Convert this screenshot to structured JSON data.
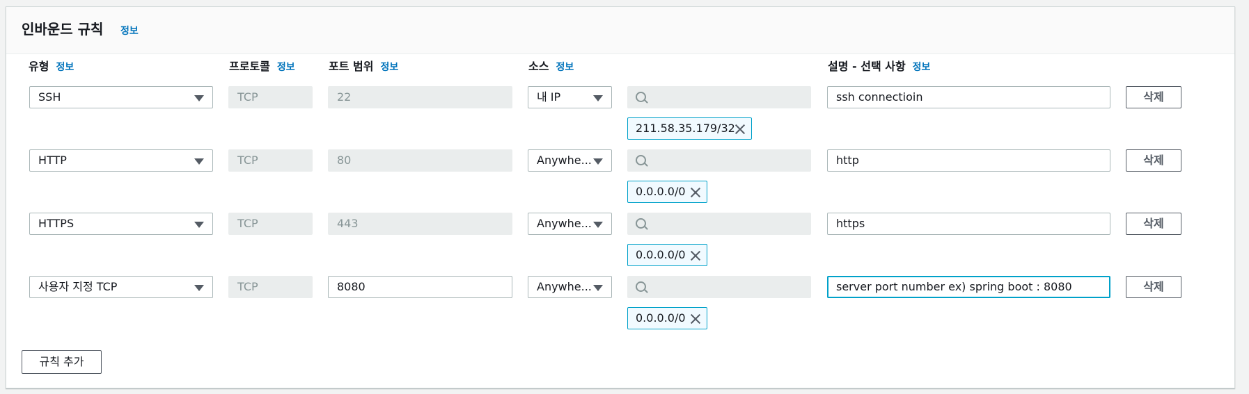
{
  "panel": {
    "title": "인바운드 규칙",
    "info": "정보"
  },
  "columns": {
    "type": "유형",
    "protocol": "프로토콜",
    "port_range": "포트 범위",
    "source": "소스",
    "description": "설명 - 선택 사항",
    "info": "정보"
  },
  "rules": [
    {
      "type": "SSH",
      "protocol": "TCP",
      "port": "22",
      "source": "내 IP",
      "token": "211.58.35.179/32",
      "description": "ssh connectioin",
      "delete": "삭제"
    },
    {
      "type": "HTTP",
      "protocol": "TCP",
      "port": "80",
      "source": "Anywhe...",
      "token": "0.0.0.0/0",
      "description": "http",
      "delete": "삭제"
    },
    {
      "type": "HTTPS",
      "protocol": "TCP",
      "port": "443",
      "source": "Anywhe...",
      "token": "0.0.0.0/0",
      "description": "https",
      "delete": "삭제"
    },
    {
      "type": "사용자 지정 TCP",
      "protocol": "TCP",
      "port": "8080",
      "source": "Anywhe...",
      "token": "0.0.0.0/0",
      "description": "server port number ex) spring boot : 8080",
      "delete": "삭제"
    }
  ],
  "add_rule_button": "규칙 추가"
}
